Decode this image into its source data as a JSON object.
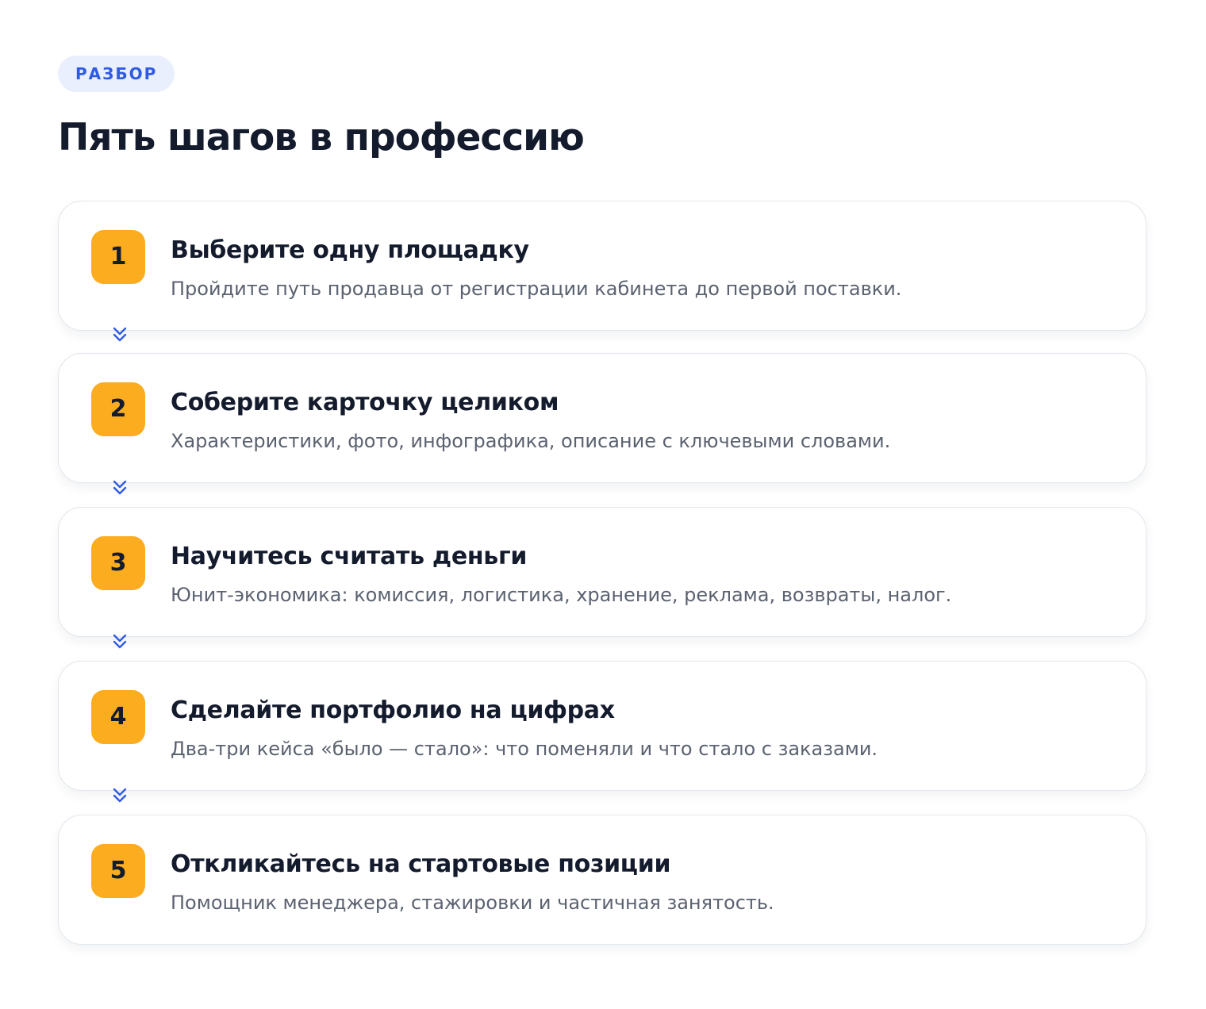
{
  "badge": "РАЗБОР",
  "title": "Пять шагов в профессию",
  "colors": {
    "accent": "#2f5be3",
    "badge_bg": "#e9effd",
    "number_bg": "#fbac1f",
    "heading": "#141b2d",
    "muted": "#5b6270"
  },
  "steps": [
    {
      "number": "1",
      "title": "Выберите одну площадку",
      "description": "Пройдите путь продавца от регистрации кабинета до первой поставки."
    },
    {
      "number": "2",
      "title": "Соберите карточку целиком",
      "description": "Характеристики, фото, инфографика, описание с ключевыми словами."
    },
    {
      "number": "3",
      "title": "Научитесь считать деньги",
      "description": "Юнит-экономика: комиссия, логистика, хранение, реклама, возвраты, налог."
    },
    {
      "number": "4",
      "title": "Сделайте портфолио на цифрах",
      "description": "Два-три кейса «было — стало»: что поменяли и что стало с заказами."
    },
    {
      "number": "5",
      "title": "Откликайтесь на стартовые позиции",
      "description": "Помощник менеджера, стажировки и частичная занятость."
    }
  ],
  "connector_icon": "double-chevron-down-icon"
}
